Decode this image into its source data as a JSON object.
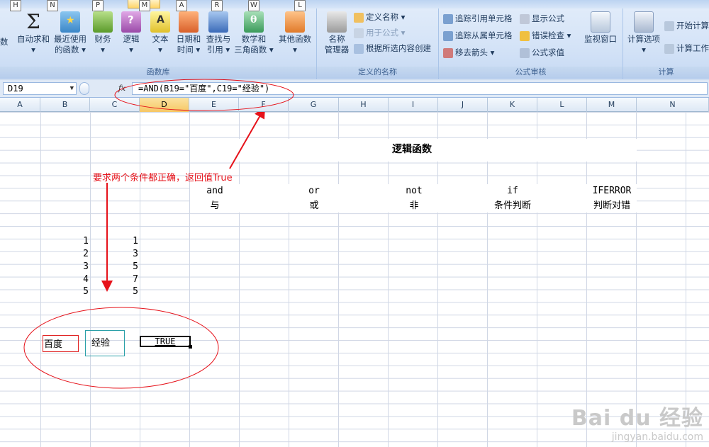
{
  "ribbon": {
    "keytips": [
      "H",
      "N",
      "P",
      "M",
      "A",
      "R",
      "W",
      "L"
    ],
    "groups": {
      "function_library": {
        "label": "函数库",
        "partial_left": "数",
        "buttons": [
          {
            "line1": "自动求和",
            "line2": "▾"
          },
          {
            "line1": "最近使用",
            "line2": "的函数 ▾"
          },
          {
            "line1": "财务",
            "line2": "▾"
          },
          {
            "line1": "逻辑",
            "line2": "▾"
          },
          {
            "line1": "文本",
            "line2": "▾"
          },
          {
            "line1": "日期和",
            "line2": "时间 ▾"
          },
          {
            "line1": "查找与",
            "line2": "引用 ▾"
          },
          {
            "line1": "数学和",
            "line2": "三角函数 ▾"
          },
          {
            "line1": "其他函数",
            "line2": "▾"
          }
        ]
      },
      "defined_names": {
        "label": "定义的名称",
        "big_button": {
          "line1": "名称",
          "line2": "管理器"
        },
        "items": [
          "定义名称 ▾",
          "用于公式 ▾",
          "根据所选内容创建"
        ]
      },
      "formula_auditing": {
        "label": "公式审核",
        "items": [
          "追踪引用单元格",
          "追踪从属单元格",
          "移去箭头 ▾",
          "显示公式",
          "错误检查 ▾",
          "公式求值"
        ],
        "watch_window": "监视窗口"
      },
      "calculation": {
        "label": "计算",
        "big_button": {
          "line1": "计算选项",
          "line2": "▾"
        },
        "items": [
          "开始计算",
          "计算工作"
        ]
      }
    }
  },
  "formula_bar": {
    "name_box": "D19",
    "fx": "fx",
    "formula": "=AND(B19=\"百度\",C19=\"经验\")"
  },
  "columns": [
    "A",
    "B",
    "C",
    "D",
    "E",
    "F",
    "G",
    "H",
    "I",
    "J",
    "K",
    "L",
    "M",
    "N"
  ],
  "selected_column": "D",
  "sheet": {
    "title": "逻辑函数",
    "functions": [
      {
        "name": "and",
        "meaning": "与"
      },
      {
        "name": "or",
        "meaning": "或"
      },
      {
        "name": "not",
        "meaning": "非"
      },
      {
        "name": "if",
        "meaning": "条件判断"
      },
      {
        "name": "IFERROR",
        "meaning": "判断对错"
      }
    ],
    "col_b_values": [
      "1",
      "2",
      "3",
      "4",
      "5"
    ],
    "col_c_values": [
      "1",
      "3",
      "5",
      "7",
      "5"
    ],
    "row19": {
      "b": "百度",
      "c": "经验",
      "d": "TRUE"
    }
  },
  "annotation": {
    "text": "要求两个条件都正确，返回值True",
    "color": "#e6121a"
  },
  "watermark": {
    "brand": "Bai du 经验",
    "url": "jingyan.baidu.com"
  }
}
